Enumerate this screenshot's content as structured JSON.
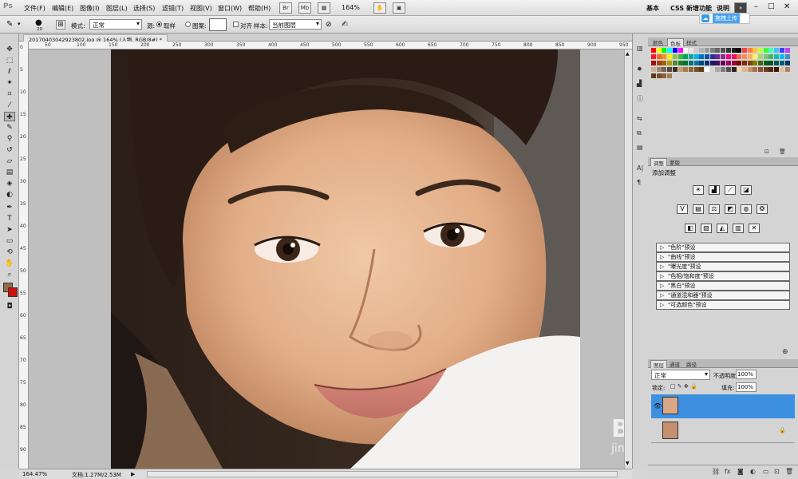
{
  "menubar": {
    "logo": "Ps",
    "menus": [
      "文件(F)",
      "编辑(E)",
      "图像(I)",
      "图层(L)",
      "选择(S)",
      "滤镜(T)",
      "视图(V)",
      "窗口(W)",
      "帮助(H)"
    ],
    "zoom_value": "164%",
    "workspace_items": [
      "基本",
      "CSS 新增功能",
      "说明"
    ],
    "upload_button": "拖拽上传"
  },
  "options": {
    "mode_label": "模式:",
    "mode_value": "正常",
    "brush_size": "20",
    "source_label": "源:",
    "sample_label": "取样",
    "pattern_label": "图案:",
    "align_label": "对齐",
    "sample_from_label": "样本:",
    "sample_from_value": "当前图层"
  },
  "document": {
    "tab_title": "20170403042923802.jpg @ 164% (人物, RGB/8#) *",
    "ruler_ticks": [
      "50",
      "100",
      "150",
      "200",
      "250",
      "300",
      "350",
      "400",
      "450",
      "500",
      "550",
      "600",
      "650",
      "700",
      "750",
      "800",
      "850",
      "900",
      "950"
    ],
    "ruler_v_ticks": [
      "0",
      "5",
      "10",
      "15",
      "20",
      "25",
      "30",
      "35",
      "40",
      "45",
      "50",
      "55",
      "60",
      "65",
      "70",
      "75",
      "80",
      "85",
      "90"
    ]
  },
  "status": {
    "zoom": "164.47%",
    "doc_info": "文档:1.27M/2.53M"
  },
  "swatches_panel": {
    "tabs": [
      "颜色",
      "色板",
      "样式"
    ],
    "active": 1
  },
  "adjustments_panel": {
    "tabs": [
      "调整",
      "蒙版"
    ],
    "title": "添加调整",
    "presets": [
      "\"色阶\"预设",
      "\"曲线\"预设",
      "\"曝光度\"预设",
      "\"色相/饱和度\"预设",
      "\"黑白\"预设",
      "\"通道混和器\"预设",
      "\"可选颜色\"预设"
    ]
  },
  "layers_panel": {
    "tabs": [
      "图层",
      "通道",
      "路径"
    ],
    "blend_mode": "正常",
    "opacity_label": "不透明度:",
    "opacity_value": "100%",
    "lock_label": "锁定:",
    "fill_label": "填充:",
    "fill_value": "100%"
  },
  "watermark": {
    "brand": "Baidu 经验",
    "url": "jingyan.baidu.com"
  },
  "colors": {
    "foreground": "#9a6a4a",
    "background": "#d01010",
    "layer_selected": "#3d8fe0"
  }
}
